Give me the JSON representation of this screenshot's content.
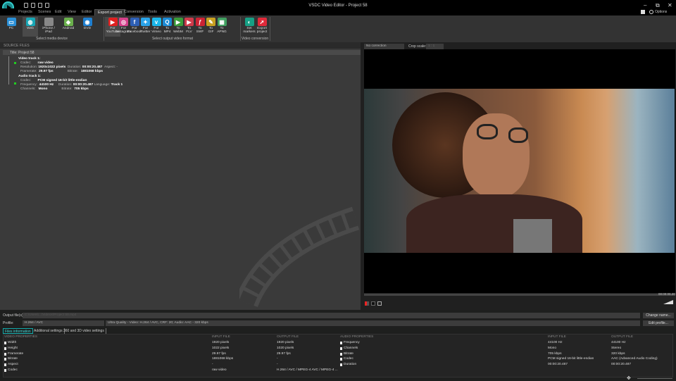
{
  "app": {
    "title": "VSDC Video Editor - Project 58"
  },
  "window_controls": {
    "minimize": "–",
    "restore": "⧉",
    "close": "✕",
    "options": "Options"
  },
  "menu": [
    "Projects",
    "Scenes",
    "Edit",
    "View",
    "Editor",
    "Export project",
    "Conversion",
    "Tools",
    "Activation"
  ],
  "ribbon": {
    "devices": [
      {
        "label": "PC",
        "color": "#2a8fd6",
        "glyph": "▭"
      },
      {
        "label": "Web",
        "color": "#17a6b5",
        "glyph": "◍"
      },
      {
        "label": "iPhone / iPad",
        "color": "#888",
        "glyph": ""
      },
      {
        "label": "Android",
        "color": "#6ab04c",
        "glyph": "◆"
      },
      {
        "label": "DVD",
        "color": "#1e7fd0",
        "glyph": "◉"
      }
    ],
    "devices_group": "Select media device",
    "formats": [
      {
        "l1": "For",
        "l2": "YouTube",
        "color": "#e02020",
        "glyph": "▶"
      },
      {
        "l1": "For",
        "l2": "Instagram",
        "color": "#d6408b",
        "glyph": "◎"
      },
      {
        "l1": "For",
        "l2": "Facebook",
        "color": "#2d5fb5",
        "glyph": "f"
      },
      {
        "l1": "For",
        "l2": "Twitter",
        "color": "#2aa3e8",
        "glyph": "✦"
      },
      {
        "l1": "For",
        "l2": "Vimeo",
        "color": "#1ab7ea",
        "glyph": "v"
      },
      {
        "l1": "To",
        "l2": "MP4",
        "color": "#1a8ad4",
        "glyph": "Q"
      },
      {
        "l1": "To",
        "l2": "WebM",
        "color": "#3a9c3a",
        "glyph": "▶"
      },
      {
        "l1": "To",
        "l2": "FLV",
        "color": "#d03a4a",
        "glyph": "▶"
      },
      {
        "l1": "To",
        "l2": "SWF",
        "color": "#cc2233",
        "glyph": "ƒ"
      },
      {
        "l1": "To",
        "l2": "GIF",
        "color": "#c8a020",
        "glyph": "✎"
      },
      {
        "l1": "To",
        "l2": "APNG",
        "color": "#40a060",
        "glyph": "▦"
      }
    ],
    "formats_group": "Select output video format",
    "conversion": [
      {
        "l1": "Set",
        "l2": "markers",
        "color": "#16a085",
        "glyph": "◐"
      },
      {
        "l1": "Export",
        "l2": "project",
        "color": "#e02a3a",
        "glyph": "➚"
      }
    ],
    "conversion_group": "Video conversion"
  },
  "source": {
    "header": "SOURCE FILES",
    "title": "Title: Project 58",
    "video": {
      "heading": "Video track 1:",
      "codec_label": "Codec:",
      "codec": "raw video",
      "res_label": "Resolution:",
      "res": "1920x1022 pixels",
      "dur_label": "Duration:",
      "dur": "00:00:20.487",
      "aspect_label": "Aspect:",
      "aspect": "-",
      "fr_label": "Framerate:",
      "fr": "29.97 fps",
      "br_label": "Bitrate:",
      "br": "1881068 kbps"
    },
    "audio": {
      "heading": "Audio track 1:",
      "codec_label": "Codec:",
      "codec": "PCM signed 16-bit little-endian",
      "freq_label": "Frequency:",
      "freq": "44100 Hz",
      "dur_label": "Duration:",
      "dur": "00:00:20.487",
      "lang_label": "Language:",
      "lang": "Track 1",
      "ch_label": "Channels:",
      "ch": "Mono",
      "br_label": "Bitrate:",
      "br": "705 kbps"
    }
  },
  "preview": {
    "correction": "No correction",
    "crop_label": "Crop scale:",
    "crop_value": "1 : 1",
    "timecode": "00:00:00.20"
  },
  "output": {
    "file_label": "Output file(s):",
    "file_value": "C:\\Users\\...\\Videos\\Project 58.mp4",
    "change_name": "Change name...",
    "profile_label": "Profile:",
    "profile": "H.264 / AVC",
    "profile_desc": "Ultra Quality - Video: H.264 / AVC, CRF: 20; Audio: AAC - 320 kbps",
    "edit_profile": "Edit profile..."
  },
  "tabs": [
    "Files information",
    "Additional settings",
    "360 and 3D video settings"
  ],
  "video_table": {
    "headers": [
      "VIDEO PROPERTIES",
      "INPUT FILE",
      "OUTPUT FILE"
    ],
    "rows": [
      [
        "Width",
        "1920 pixels",
        "1920 pixels"
      ],
      [
        "Height",
        "1022 pixels",
        "1020 pixels"
      ],
      [
        "Framerate",
        "29.97 fps",
        "29.97 fps"
      ],
      [
        "Bitrate",
        "1881068 kbps",
        "-"
      ],
      [
        "Aspect",
        "-",
        "-"
      ],
      [
        "Codec",
        "raw video",
        "H.264 / AVC / MPEG-4 AVC / MPEG-4 ..."
      ]
    ]
  },
  "audio_table": {
    "headers": [
      "AUDIO PROPERTIES",
      "INPUT FILE",
      "OUTPUT FILE"
    ],
    "rows": [
      [
        "Frequency",
        "44100 Hz",
        "44100 Hz"
      ],
      [
        "Channels",
        "Mono",
        "Stereo"
      ],
      [
        "Bitrate",
        "705 kbps",
        "320 kbps"
      ],
      [
        "Codec",
        "PCM signed 16-bit little-endian",
        "AAC (Advanced Audio Coding)"
      ],
      [
        "Duration",
        "00:00:20.487",
        "00:00:20.487"
      ]
    ]
  }
}
